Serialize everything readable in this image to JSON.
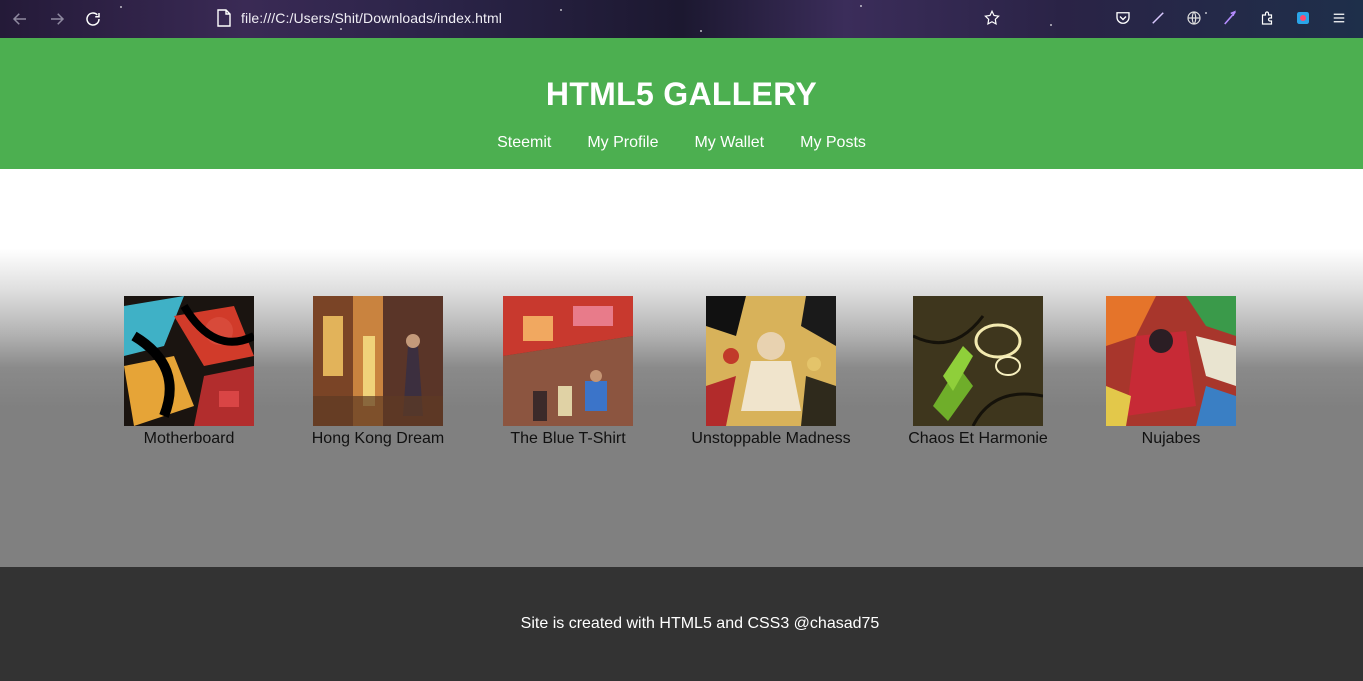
{
  "browser": {
    "url": "file:///C:/Users/Shit/Downloads/index.html",
    "icons": [
      "back-icon",
      "forward-icon",
      "reload-icon",
      "page-icon",
      "bookmark-star-icon",
      "pocket-icon",
      "extension-pen-icon",
      "globe-icon",
      "extension-feather-icon",
      "extensions-puzzle-icon",
      "profile-extension-icon",
      "menu-icon"
    ]
  },
  "header": {
    "title": "HTML5 GALLERY",
    "nav": [
      "Steemit",
      "My Profile",
      "My Wallet",
      "My Posts"
    ],
    "background": "#4caf50"
  },
  "gallery": {
    "items": [
      {
        "caption": "Motherboard"
      },
      {
        "caption": "Hong Kong Dream"
      },
      {
        "caption": "The Blue T-Shirt"
      },
      {
        "caption": "Unstoppable Madness"
      },
      {
        "caption": "Chaos Et Harmonie"
      },
      {
        "caption": "Nujabes"
      }
    ]
  },
  "footer": {
    "text": "Site is created with HTML5 and CSS3 @chasad75",
    "background": "#333333"
  }
}
